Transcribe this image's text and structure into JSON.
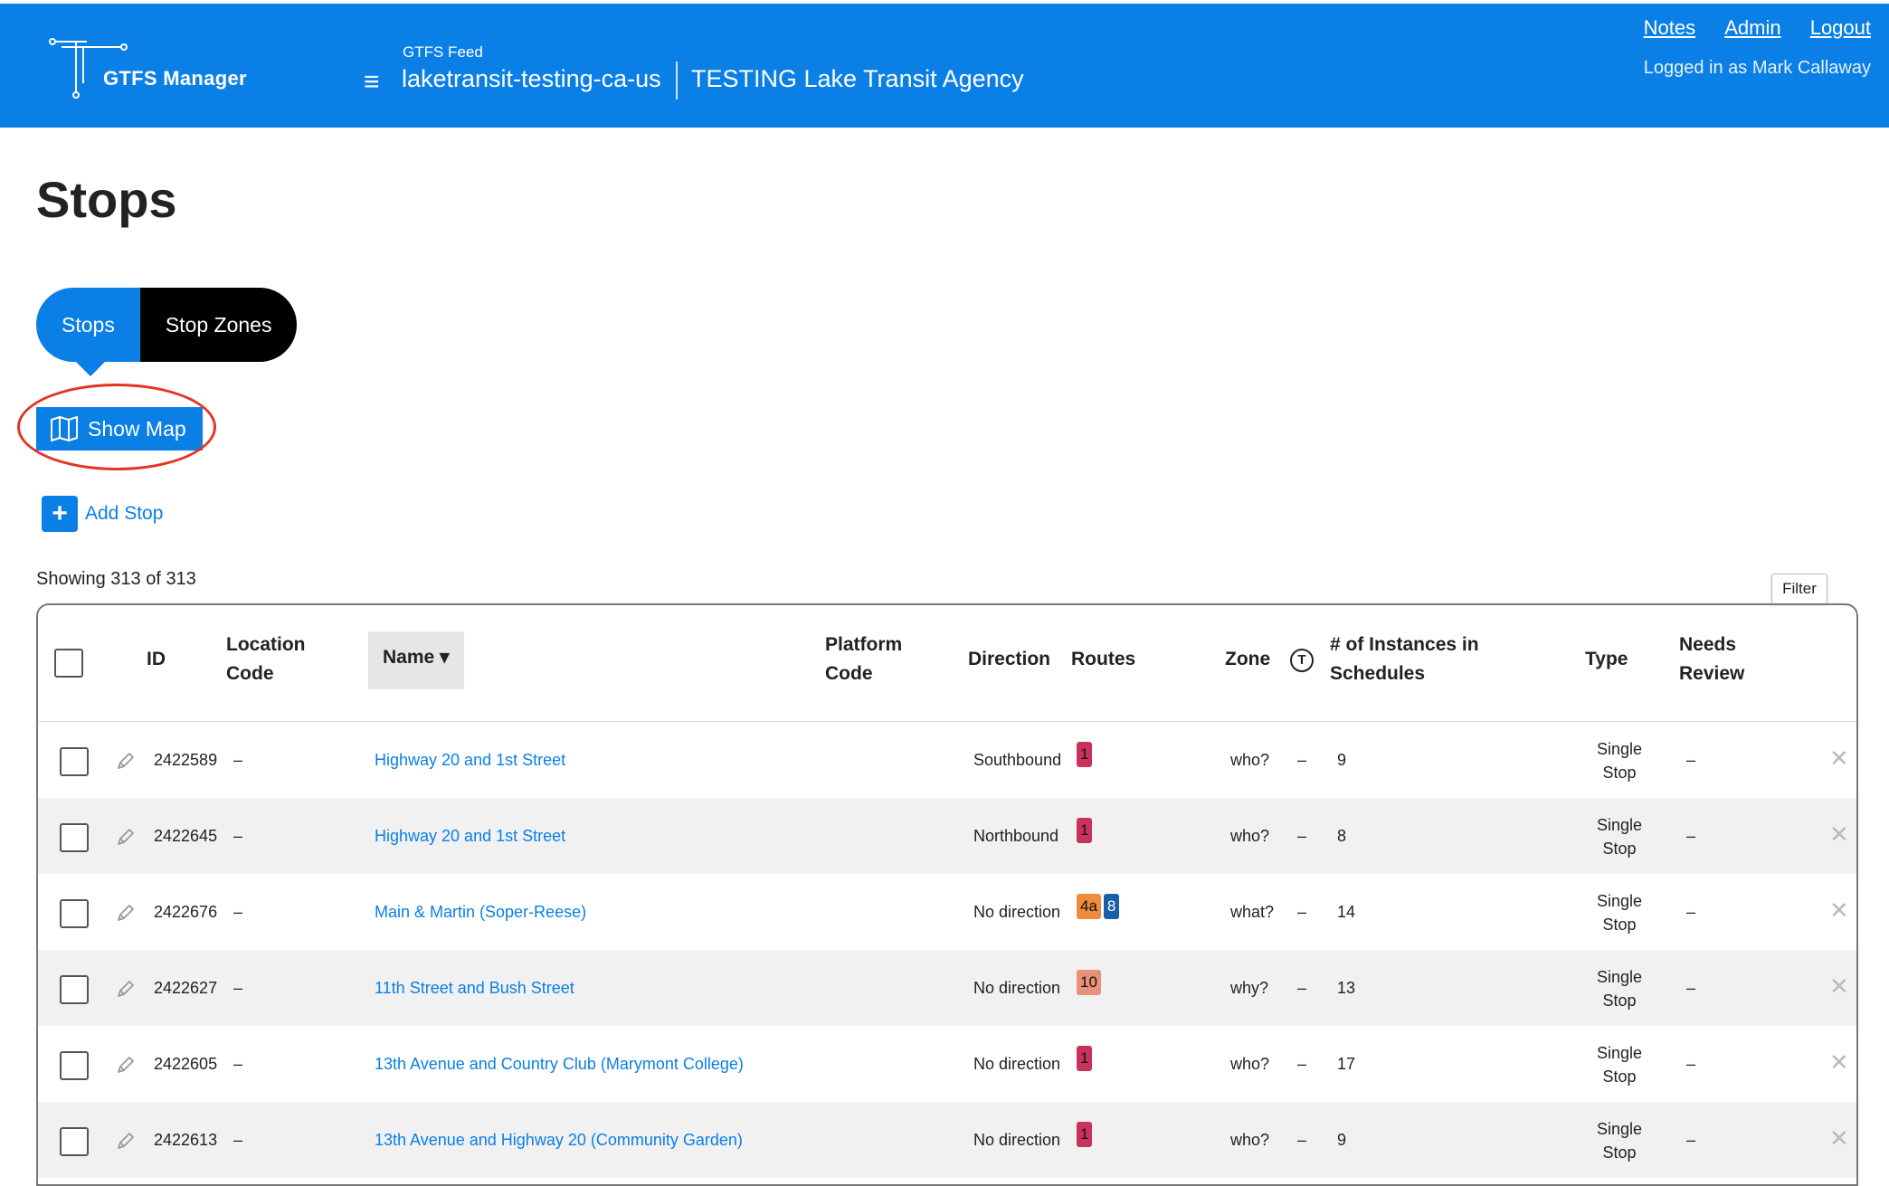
{
  "header": {
    "brand": "GTFS Manager",
    "feed_label": "GTFS Feed",
    "feed_name": "laketransit-testing-ca-us",
    "agency_name": "TESTING Lake Transit Agency",
    "links": {
      "notes": "Notes",
      "admin": "Admin",
      "logout": "Logout"
    },
    "logged_in": "Logged in as Mark Callaway",
    "menu_icon": "≡"
  },
  "page_title": "Stops",
  "tabs": {
    "stops": "Stops",
    "stop_zones": "Stop Zones"
  },
  "show_map_label": "Show Map",
  "add_stop_label": "Add Stop",
  "showing_text": "Showing 313 of 313",
  "filter_label": "Filter",
  "columns": {
    "id": "ID",
    "location_code": [
      "Location",
      "Code"
    ],
    "name": "Name ▾",
    "platform_code": [
      "Platform",
      "Code"
    ],
    "direction": "Direction",
    "routes": "Routes",
    "zone": "Zone",
    "transit_icon": "T",
    "instances": [
      "# of Instances in",
      "Schedules"
    ],
    "type": "Type",
    "needs_review": [
      "Needs",
      "Review"
    ]
  },
  "route_colors": {
    "1": "#c8325c",
    "4a": "#f08a3c",
    "8": "#1b5fa8",
    "10": "#e7907a"
  },
  "rows": [
    {
      "id": "2422589",
      "loc": "–",
      "name": "Highway 20 and 1st Street",
      "direction": "Southbound",
      "routes": [
        "1"
      ],
      "zone": "who?",
      "transit": "–",
      "instances": "9",
      "type": [
        "Single",
        "Stop"
      ],
      "review": "–",
      "delete_icon": "✕"
    },
    {
      "id": "2422645",
      "loc": "–",
      "name": "Highway 20 and 1st Street",
      "direction": "Northbound",
      "routes": [
        "1"
      ],
      "zone": "who?",
      "transit": "–",
      "instances": "8",
      "type": [
        "Single",
        "Stop"
      ],
      "review": "–",
      "delete_icon": "✕"
    },
    {
      "id": "2422676",
      "loc": "–",
      "name": "Main & Martin (Soper-Reese)",
      "direction": "No direction",
      "routes": [
        "4a",
        "8"
      ],
      "zone": "what?",
      "transit": "–",
      "instances": "14",
      "type": [
        "Single",
        "Stop"
      ],
      "review": "–",
      "delete_icon": "✕"
    },
    {
      "id": "2422627",
      "loc": "–",
      "name": "11th Street and Bush Street",
      "direction": "No direction",
      "routes": [
        "10"
      ],
      "zone": "why?",
      "transit": "–",
      "instances": "13",
      "type": [
        "Single",
        "Stop"
      ],
      "review": "–",
      "delete_icon": "✕"
    },
    {
      "id": "2422605",
      "loc": "–",
      "name": "13th Avenue and Country Club (Marymont College)",
      "direction": "No direction",
      "routes": [
        "1"
      ],
      "zone": "who?",
      "transit": "–",
      "instances": "17",
      "type": [
        "Single",
        "Stop"
      ],
      "review": "–",
      "delete_icon": "✕"
    },
    {
      "id": "2422613",
      "loc": "–",
      "name": "13th Avenue and Highway 20 (Community Garden)",
      "direction": "No direction",
      "routes": [
        "1"
      ],
      "zone": "who?",
      "transit": "–",
      "instances": "9",
      "type": [
        "Single",
        "Stop"
      ],
      "review": "–",
      "delete_icon": "✕"
    }
  ],
  "annotation_color": "#e53323"
}
